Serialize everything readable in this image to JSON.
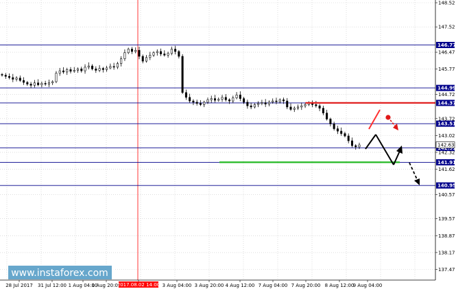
{
  "chart_data": {
    "type": "candlestick",
    "y_axis": {
      "min": 137.2,
      "max": 148.52,
      "ticks": [
        "148.52",
        "148.22",
        "147.92",
        "147.62",
        "147.32",
        "147.02",
        "146.72",
        "146.42",
        "146.12",
        "145.82",
        "145.52",
        "145.22",
        "144.92",
        "144.62",
        "144.32",
        "144.02",
        "143.72",
        "143.42",
        "143.12",
        "142.82",
        "142.52",
        "142.22",
        "141.92",
        "141.62",
        "141.32",
        "141.02",
        "140.72",
        "140.42",
        "140.12",
        "139.82",
        "139.52",
        "139.22",
        "138.92",
        "138.62",
        "138.32",
        "138.02",
        "137.72",
        "137.42"
      ],
      "labels": [
        {
          "value": 148.52,
          "text": "148.52"
        },
        {
          "value": 147.52,
          "text": "147.52"
        },
        {
          "value": 146.47,
          "text": "146.47"
        },
        {
          "value": 145.77,
          "text": "145.77"
        },
        {
          "value": 144.72,
          "text": "144.72"
        },
        {
          "value": 143.72,
          "text": "143.72"
        },
        {
          "value": 143.02,
          "text": "143.02"
        },
        {
          "value": 142.32,
          "text": "142.32"
        },
        {
          "value": 141.62,
          "text": "141.62"
        },
        {
          "value": 140.57,
          "text": "140.57"
        },
        {
          "value": 139.57,
          "text": "139.57"
        },
        {
          "value": 138.87,
          "text": "138.87"
        },
        {
          "value": 138.17,
          "text": "138.17"
        },
        {
          "value": 137.47,
          "text": "137.47"
        }
      ]
    },
    "x_labels": [
      "28 Jul 2017",
      "31 Jul 12:00",
      "1 Aug 04:00",
      "1 Aug 20:00",
      "2017.08.02 14:00",
      "3 Aug 04:00",
      "3 Aug 20:00",
      "4 Aug 12:00",
      "7 Aug 04:00",
      "7 Aug 20:00",
      "8 Aug 12:00",
      "9 Aug 04:00"
    ],
    "levels": [
      {
        "value": 146.77,
        "label": "146.77",
        "color": "#00008b"
      },
      {
        "value": 144.99,
        "label": "144.99",
        "color": "#00008b"
      },
      {
        "value": 144.37,
        "label": "144.37",
        "color": "#00008b"
      },
      {
        "value": 143.51,
        "label": "143.51",
        "color": "#00008b"
      },
      {
        "value": 142.51,
        "label": "142.51",
        "color": "#00008b"
      },
      {
        "value": 141.91,
        "label": "141.91",
        "color": "#00008b"
      },
      {
        "value": 140.95,
        "label": "140.95",
        "color": "#00008b"
      }
    ],
    "current_price_label": "142.63",
    "red_segment": {
      "value": 144.37,
      "x_from": 0.67,
      "x_to": 1.0
    },
    "green_segment": {
      "value": 141.91,
      "x_from": 0.48,
      "x_to": 0.88
    },
    "cursor_label": "2017.08.02 14:00",
    "closes": [
      145.52,
      145.47,
      145.42,
      145.35,
      145.4,
      145.3,
      145.22,
      145.15,
      145.1,
      145.2,
      145.12,
      145.18,
      145.15,
      145.2,
      145.25,
      145.6,
      145.7,
      145.65,
      145.75,
      145.68,
      145.72,
      145.78,
      145.7,
      145.85,
      145.9,
      145.78,
      145.72,
      145.8,
      145.75,
      145.82,
      145.88,
      145.85,
      146.0,
      146.2,
      146.45,
      146.6,
      146.5,
      146.55,
      146.3,
      146.1,
      146.25,
      146.35,
      146.45,
      146.5,
      146.4,
      146.35,
      146.42,
      146.6,
      146.5,
      146.3,
      144.8,
      144.6,
      144.45,
      144.4,
      144.35,
      144.3,
      144.4,
      144.5,
      144.55,
      144.48,
      144.52,
      144.6,
      144.5,
      144.45,
      144.58,
      144.7,
      144.55,
      144.4,
      144.25,
      144.2,
      144.3,
      144.35,
      144.38,
      144.32,
      144.4,
      144.45,
      144.42,
      144.5,
      144.45,
      144.2,
      144.1,
      144.15,
      144.2,
      144.25,
      144.3,
      144.35,
      144.3,
      144.25,
      144.15,
      143.95,
      143.7,
      143.5,
      143.3,
      143.2,
      143.1,
      143.0,
      142.8,
      142.6,
      142.55,
      142.63
    ],
    "annotations": {
      "red_arrow": "down",
      "black_path": "down-up-down"
    },
    "watermark": "www.instaforex.com"
  }
}
